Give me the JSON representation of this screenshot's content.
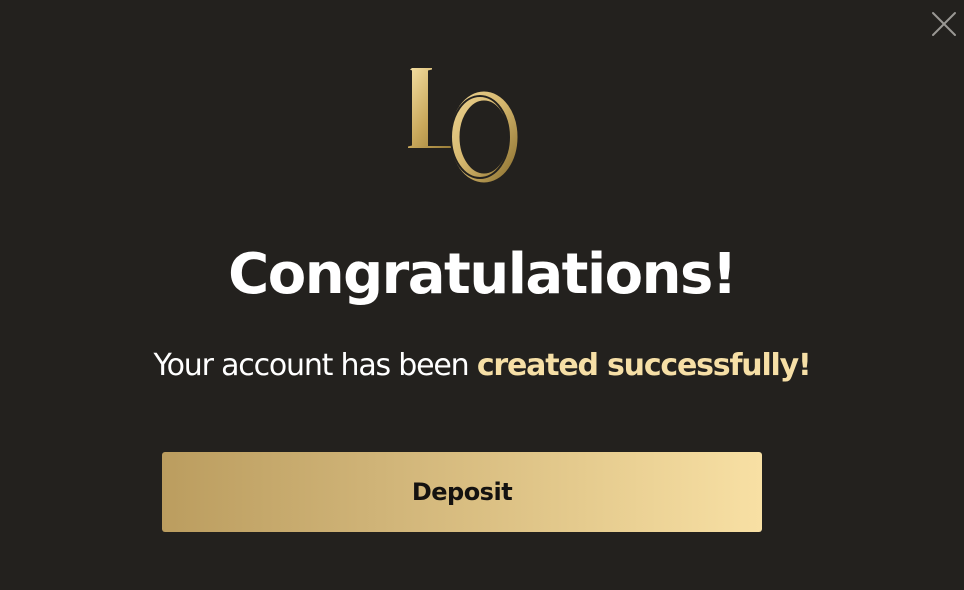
{
  "modal": {
    "close_icon": "close-icon",
    "logo": {
      "letters": [
        "L",
        "O"
      ],
      "colors": {
        "gold_light": "#f4dfa3",
        "gold_mid": "#c9a85b",
        "gold_dark": "#8e7330"
      }
    },
    "title": "Congratulations!",
    "message_prefix": "Your account has been",
    "message_highlight": "created successfully!",
    "primary_button_label": "Deposit"
  },
  "colors": {
    "background": "#23211e",
    "text": "#ffffff",
    "highlight": "#f6dfa6",
    "button_gradient_start": "#bb9d5f",
    "button_gradient_end": "#f8e0a4",
    "button_text": "#141210"
  }
}
